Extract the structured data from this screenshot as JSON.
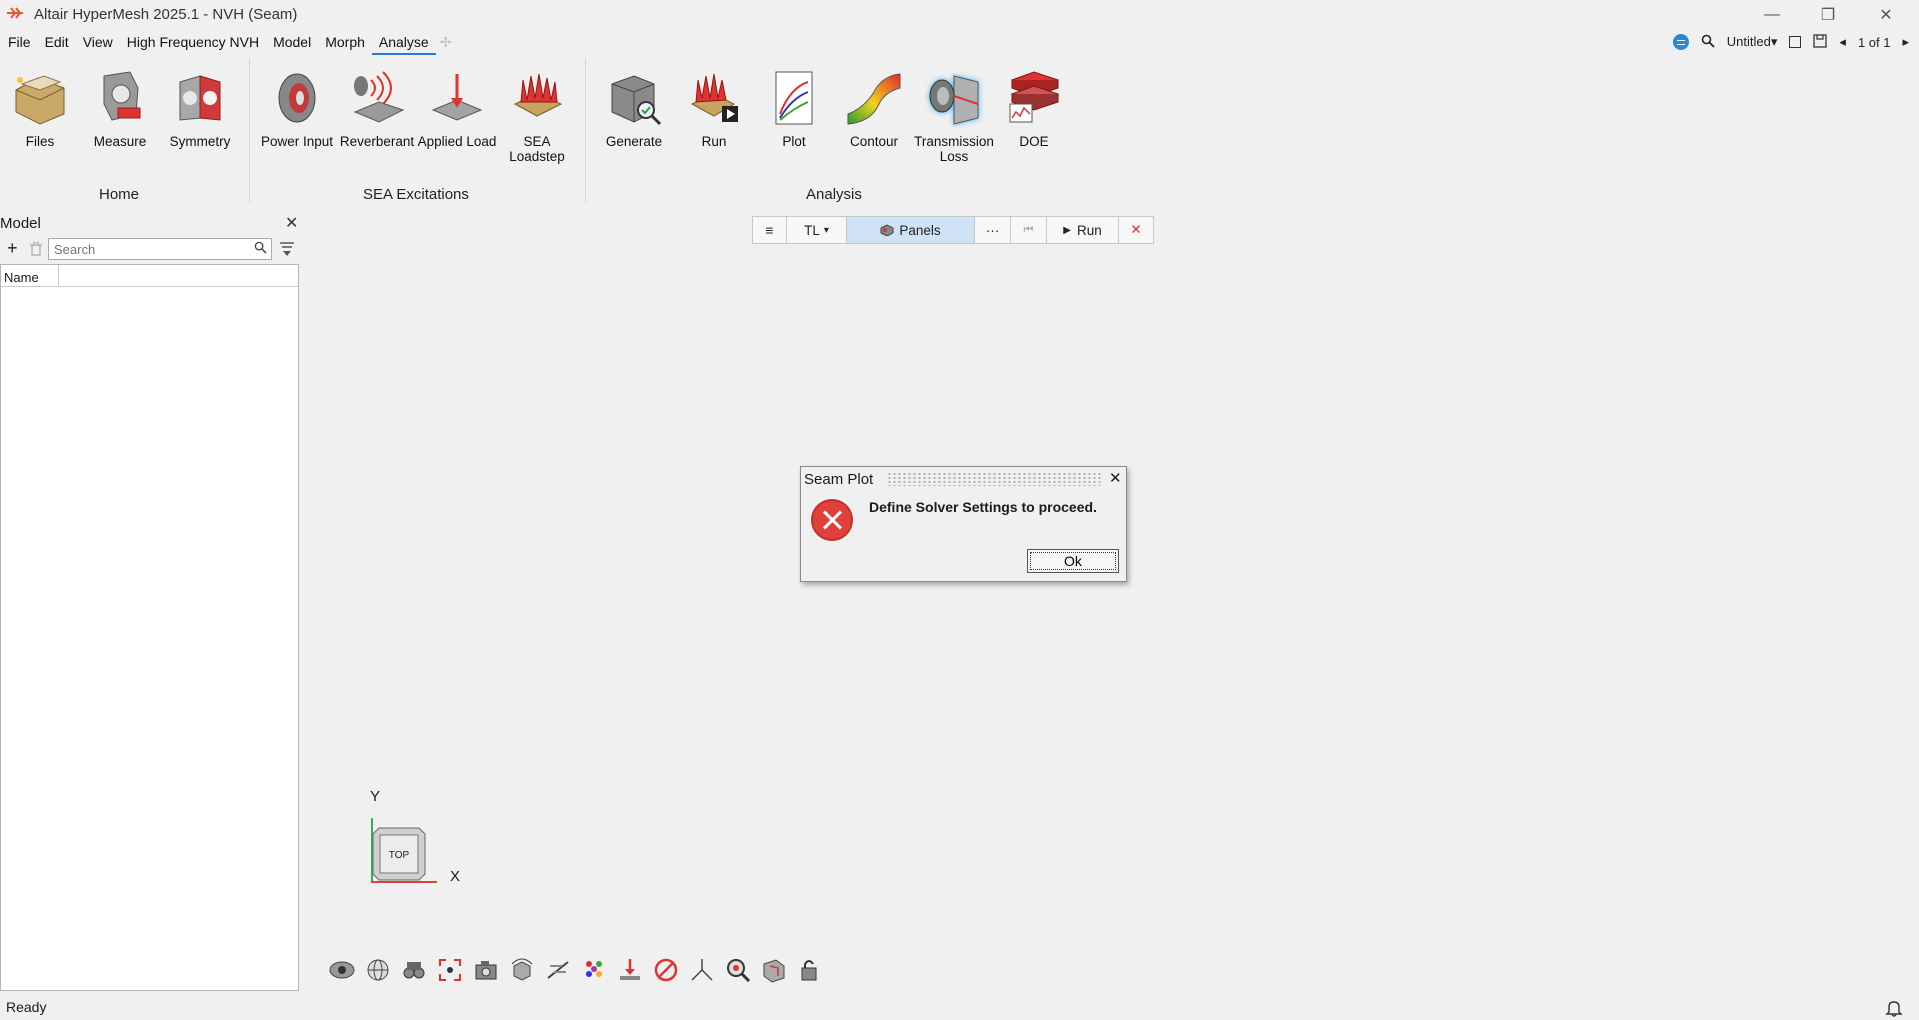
{
  "window": {
    "title": "Altair HyperMesh 2025.1 - NVH (Seam)",
    "minimize": "—",
    "restore": "❐",
    "close": "✕"
  },
  "menu": {
    "items": [
      "File",
      "Edit",
      "View",
      "High Frequency NVH",
      "Model",
      "Morph",
      "Analyse"
    ],
    "active": "Analyse",
    "plus": "✢"
  },
  "topright": {
    "document": "Untitled",
    "page_prev": "◂",
    "page": "1 of 1",
    "page_next": "▸"
  },
  "ribbon": {
    "groups": [
      {
        "label": "Home",
        "tools": [
          {
            "label": "Files",
            "icon": "files-icon"
          },
          {
            "label": "Measure",
            "icon": "measure-icon"
          },
          {
            "label": "Symmetry",
            "icon": "symmetry-icon"
          }
        ]
      },
      {
        "label": "SEA Excitations",
        "tools": [
          {
            "label": "Power Input",
            "icon": "speaker-icon"
          },
          {
            "label": "Reverberant",
            "icon": "reverberant-icon"
          },
          {
            "label": "Applied Load",
            "icon": "applied-load-icon"
          },
          {
            "label": "SEA Loadstep",
            "icon": "loadstep-icon"
          }
        ]
      },
      {
        "label": "Analysis",
        "tools": [
          {
            "label": "Generate",
            "icon": "generate-icon"
          },
          {
            "label": "Run",
            "icon": "run-icon"
          },
          {
            "label": "Plot",
            "icon": "plot-icon"
          },
          {
            "label": "Contour",
            "icon": "contour-icon"
          },
          {
            "label": "Transmission Loss",
            "icon": "transmission-loss-icon"
          },
          {
            "label": "DOE",
            "icon": "doe-icon"
          }
        ]
      }
    ]
  },
  "model_browser": {
    "title": "Model",
    "close": "✕",
    "add": "+",
    "search_placeholder": "Search",
    "column_name": "Name"
  },
  "graphics_toolbar": {
    "menu": "≡",
    "mode": "TL",
    "panels": "Panels",
    "more": "···",
    "first": "⏮",
    "run": "Run",
    "close": "✕"
  },
  "dialog": {
    "title": "Seam Plot",
    "close": "✕",
    "message": "Define Solver Settings to proceed.",
    "ok": "Ok"
  },
  "view_cube": {
    "face": "TOP",
    "y_label": "Y",
    "x_label": "X"
  },
  "status": {
    "text": "Ready"
  },
  "colors": {
    "accent": "#2b7bd6",
    "error": "#e0403a",
    "panels_bg": "#cfe3f4",
    "brand": "#e8562a"
  }
}
